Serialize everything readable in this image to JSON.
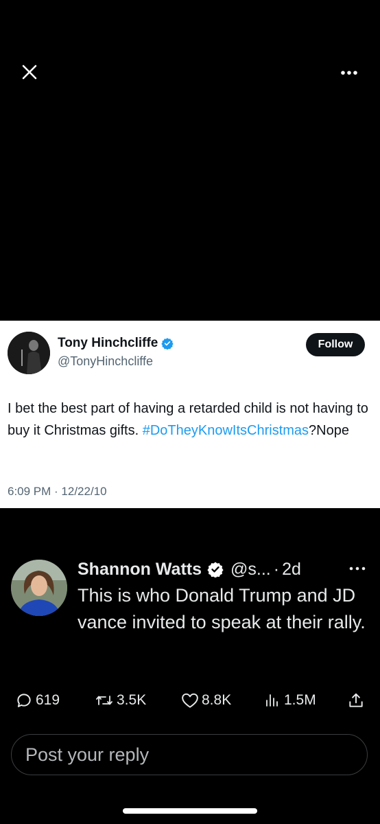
{
  "top_bar": {
    "close_icon": "close-icon",
    "more_icon": "more-dots-icon"
  },
  "embedded_tweet": {
    "author_name": "Tony Hinchcliffe",
    "author_handle": "@TonyHinchcliffe",
    "verified_icon": "verified-badge-icon",
    "follow_label": "Follow",
    "text_plain": "I bet the best part of having a retarded child is not having to buy it Christmas gifts.",
    "hashtag": "#DoTheyKnowItsChristmas",
    "text_after": "?Nope",
    "timestamp": "6:09 PM · 12/22/10"
  },
  "post": {
    "author_name": "Shannon Watts",
    "verified_icon": "verified-badge-icon",
    "author_handle": "@s...",
    "separator": "·",
    "age": "2d",
    "text": "This is who Donald Trump and JD vance invited to speak at their rally."
  },
  "actions": {
    "replies": "619",
    "reposts": "3.5K",
    "likes": "8.8K",
    "views": "1.5M"
  },
  "reply_box": {
    "placeholder": "Post your reply"
  },
  "colors": {
    "background": "#000000",
    "text": "#e7e9ea",
    "link": "#1d9bf0",
    "card_background": "#ffffff"
  }
}
